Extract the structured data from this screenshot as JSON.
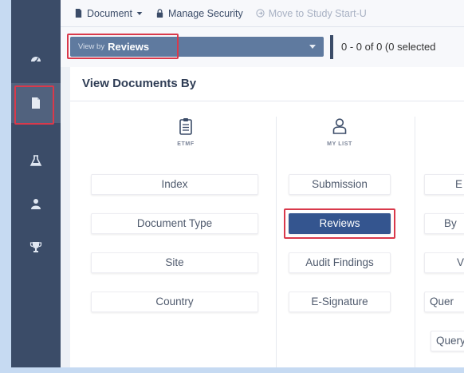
{
  "toolbar": {
    "document_label": "Document",
    "manage_security_label": "Manage Security",
    "move_to_study_label": "Move to Study Start-U"
  },
  "view_by": {
    "prefix": "View by",
    "value": "Reviews"
  },
  "pagination": {
    "summary": "0 - 0 of 0 (0 selected"
  },
  "card": {
    "title": "View Documents By"
  },
  "columns": [
    {
      "header": "ETMF",
      "icon": "clipboard-icon",
      "options": [
        "Index",
        "Document Type",
        "Site",
        "Country"
      ]
    },
    {
      "header": "MY LIST",
      "icon": "user-icon",
      "options": [
        "Submission",
        "Reviews",
        "Audit Findings",
        "E-Signature"
      ],
      "selected": "Reviews"
    },
    {
      "header": "",
      "icon": "",
      "options": [
        "E",
        "By",
        "V",
        "Quer",
        "Query"
      ]
    }
  ],
  "left_nav": {
    "items": [
      "dashboard-icon",
      "document-icon",
      "flask-icon",
      "user-icon",
      "trophy-icon"
    ],
    "active": "document-icon"
  },
  "colors": {
    "nav_bg": "#3b4c68",
    "selected_option": "#34558f",
    "highlight": "#d9394b",
    "page_bg": "#c6daf2"
  }
}
